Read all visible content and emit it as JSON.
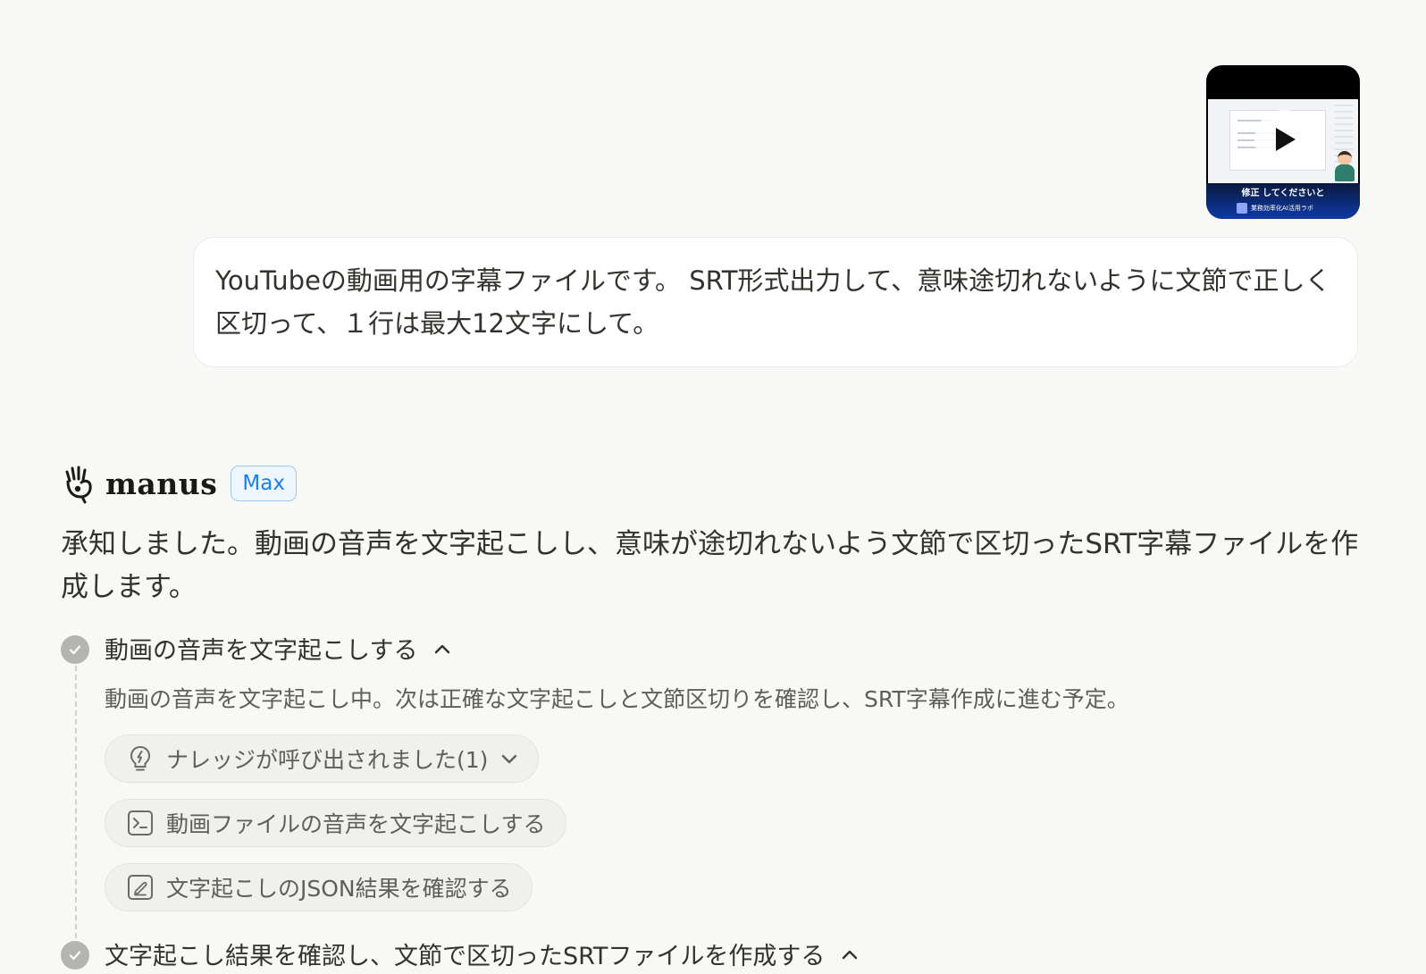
{
  "thumbnail": {
    "caption": "修正 してくださいと",
    "channel": "業務効率化AI活用ラボ"
  },
  "user_message": {
    "text": "YouTubeの動画用の字幕ファイルです。 SRT形式出力して、意味途切れないように文節で正しく区切って、１行は最大12文字にして。"
  },
  "assistant": {
    "brand": "manus",
    "badge": "Max",
    "message": "承知しました。動画の音声を文字起こしし、意味が途切れないよう文節で区切ったSRT字幕ファイルを作成します。"
  },
  "steps": [
    {
      "title": "動画の音声を文字起こしする",
      "description": "動画の音声を文字起こし中。次は正確な文字起こしと文節区切りを確認し、SRT字幕作成に進む予定。",
      "actions": [
        {
          "label": "ナレッジが呼び出されました(1)",
          "icon": "lightbulb-icon"
        },
        {
          "label": "動画ファイルの音声を文字起こしする",
          "icon": "terminal-icon"
        },
        {
          "label": "文字起こしのJSON結果を確認する",
          "icon": "edit-icon"
        }
      ]
    },
    {
      "title": "文字起こし結果を確認し、文節で区切ったSRTファイルを作成する"
    }
  ],
  "colors": {
    "background": "#f8f8f7",
    "badge_text": "#1a7ff0",
    "badge_border": "#9cc8f6",
    "check_circle": "#b4b4b1"
  }
}
